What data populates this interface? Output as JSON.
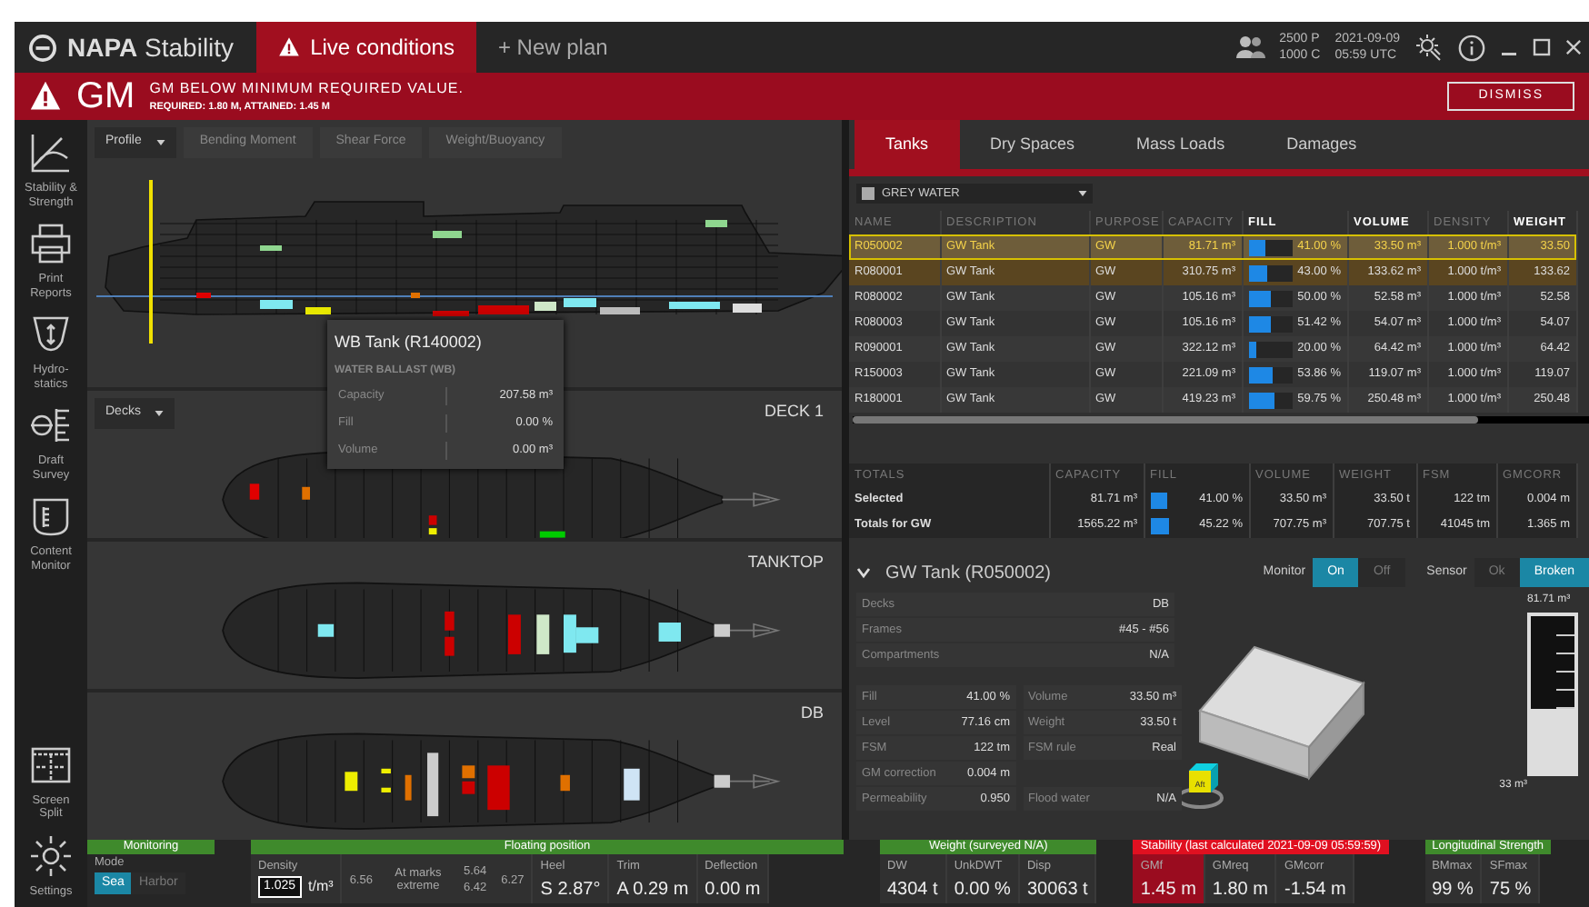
{
  "app": {
    "logo": "**NAPA** Stability",
    "tabs": [
      {
        "label": "Live conditions",
        "selected": true,
        "kind": "warning"
      },
      {
        "label": "+ New plan",
        "selected": false,
        "kind": "plain"
      }
    ],
    "persons": [
      "2500 P",
      "1000 C"
    ],
    "datetime": [
      "2021-09-09",
      "05:59 UTC"
    ]
  },
  "alert": {
    "code": "GM",
    "title": "GM BELOW MINIMUM REQUIRED VALUE.",
    "detail": "REQUIRED: 1.80 M, ATTAINED: 1.45 M",
    "button": "DISMISS"
  },
  "sidebar": {
    "items": [
      {
        "lines": [
          "Stability &",
          "Strength"
        ],
        "kind": "stability"
      },
      {
        "lines": [
          "Print",
          "Reports"
        ],
        "kind": "print"
      },
      {
        "lines": [
          "Hydro-",
          "statics"
        ],
        "kind": "hydro"
      },
      {
        "lines": [
          "Draft",
          "Survey"
        ],
        "kind": "draft"
      },
      {
        "lines": [
          "Content",
          "Monitor"
        ],
        "kind": "content"
      }
    ],
    "bottom": [
      {
        "lines": [
          "Screen",
          "Split"
        ],
        "kind": "split"
      },
      {
        "lines": [
          "Settings"
        ],
        "kind": "settings"
      }
    ]
  },
  "profile": {
    "view_select": "Profile",
    "tabs": [
      "Bending Moment",
      "Shear Force",
      "Weight/Buoyancy"
    ],
    "tooltip": {
      "title": "WB Tank (R140002)",
      "subtitle": "WATER BALLAST (WB)",
      "rows": [
        {
          "label": "Capacity",
          "value": "207.58 m³"
        },
        {
          "label": "Fill",
          "value": "0.00 %"
        },
        {
          "label": "Volume",
          "value": "0.00 m³"
        }
      ]
    }
  },
  "decks": {
    "select": "Decks",
    "views": [
      {
        "label": "DECK 1",
        "kind": "deck1"
      },
      {
        "label": "TANKTOP",
        "kind": "tanktop"
      },
      {
        "label": "DB",
        "kind": "db"
      }
    ]
  },
  "tanks_panel": {
    "tabs": [
      {
        "label": "Tanks",
        "selected": true
      },
      {
        "label": "Dry Spaces",
        "selected": false
      },
      {
        "label": "Mass Loads",
        "selected": false
      },
      {
        "label": "Damages",
        "selected": false
      }
    ],
    "filter": {
      "label": "GREY WATER",
      "checked": false
    },
    "columns": [
      {
        "label": "NAME",
        "emphasis": false
      },
      {
        "label": "DESCRIPTION",
        "emphasis": false
      },
      {
        "label": "PURPOSE",
        "emphasis": false
      },
      {
        "label": "CAPACITY",
        "emphasis": false
      },
      {
        "label": "FILL",
        "emphasis": true
      },
      {
        "label": "VOLUME",
        "emphasis": true
      },
      {
        "label": "DENSITY",
        "emphasis": false
      },
      {
        "label": "WEIGHT",
        "emphasis": true
      }
    ],
    "rows": [
      {
        "name": "R050002",
        "description": "GW Tank",
        "purpose": "GW",
        "capacity": "81.71 m³",
        "fill": "41.00 %",
        "level": 0.41,
        "volume": "33.50 m³",
        "density": "1.000 t/m³",
        "weight": "33.50",
        "selected": true,
        "highlighted": false
      },
      {
        "name": "R080001",
        "description": "GW Tank",
        "purpose": "GW",
        "capacity": "310.75 m³",
        "fill": "43.00 %",
        "level": 0.43,
        "volume": "133.62 m³",
        "density": "1.000 t/m³",
        "weight": "133.62",
        "selected": false,
        "highlighted": true
      },
      {
        "name": "R080002",
        "description": "GW Tank",
        "purpose": "GW",
        "capacity": "105.16 m³",
        "fill": "50.00 %",
        "level": 0.5,
        "volume": "52.58 m³",
        "density": "1.000 t/m³",
        "weight": "52.58",
        "selected": false,
        "highlighted": false
      },
      {
        "name": "R080003",
        "description": "GW Tank",
        "purpose": "GW",
        "capacity": "105.16 m³",
        "fill": "51.42 %",
        "level": 0.5142,
        "volume": "54.07 m³",
        "density": "1.000 t/m³",
        "weight": "54.07",
        "selected": false,
        "highlighted": false
      },
      {
        "name": "R090001",
        "description": "GW Tank",
        "purpose": "GW",
        "capacity": "322.12 m³",
        "fill": "20.00 %",
        "level": 0.2,
        "volume": "64.42 m³",
        "density": "1.000 t/m³",
        "weight": "64.42",
        "selected": false,
        "highlighted": false
      },
      {
        "name": "R150003",
        "description": "GW Tank",
        "purpose": "GW",
        "capacity": "221.09 m³",
        "fill": "53.86 %",
        "level": 0.5386,
        "volume": "119.07 m³",
        "density": "1.000 t/m³",
        "weight": "119.07",
        "selected": false,
        "highlighted": false
      },
      {
        "name": "R180001",
        "description": "GW Tank",
        "purpose": "GW",
        "capacity": "419.23 m³",
        "fill": "59.75 %",
        "level": 0.5975,
        "volume": "250.48 m³",
        "density": "1.000 t/m³",
        "weight": "250.48",
        "selected": false,
        "highlighted": false
      }
    ]
  },
  "totals": {
    "columns": [
      "TOTALS",
      "CAPACITY",
      "FILL",
      "VOLUME",
      "WEIGHT",
      "FSM",
      "GMCORR"
    ],
    "rows": [
      {
        "label": "Selected",
        "capacity": "81.71 m³",
        "fill": "41.00 %",
        "level": 0.41,
        "volume": "33.50 m³",
        "weight": "33.50 t",
        "fsm": "122 tm",
        "gmcorr": "0.004 m"
      },
      {
        "label": "Totals for GW",
        "capacity": "1565.22 m³",
        "fill": "45.22 %",
        "level": 0.4522,
        "volume": "707.75 m³",
        "weight": "707.75 t",
        "fsm": "41045 tm",
        "gmcorr": "1.365 m"
      }
    ]
  },
  "detail": {
    "title": "GW Tank (R050002)",
    "expanded": true,
    "monitor": {
      "label": "Monitor",
      "options": [
        {
          "label": "On",
          "selected": true
        },
        {
          "label": "Off",
          "selected": false
        }
      ]
    },
    "sensor": {
      "label": "Sensor",
      "options": [
        {
          "label": "Ok",
          "selected": false
        },
        {
          "label": "Broken",
          "selected": true
        }
      ]
    },
    "info": [
      {
        "label": "Decks",
        "value": "DB"
      },
      {
        "label": "Frames",
        "value": "#45 - #56"
      },
      {
        "label": "Compartments",
        "value": "N/A"
      }
    ],
    "props": [
      [
        {
          "label": "Fill",
          "value": "41.00 %"
        },
        {
          "label": "Volume",
          "value": "33.50 m³"
        }
      ],
      [
        {
          "label": "Level",
          "value": "77.16 cm"
        },
        {
          "label": "Weight",
          "value": "33.50 t"
        }
      ],
      [
        {
          "label": "FSM",
          "value": "122 tm"
        },
        {
          "label": "FSM rule",
          "value": "Real"
        }
      ],
      [
        {
          "label": "GM correction",
          "value": "0.004 m"
        }
      ],
      [
        {
          "label": "Permeability",
          "value": "0.950"
        },
        {
          "label": "Flood water",
          "value": "N/A"
        }
      ]
    ],
    "cube_label": "Aft",
    "gauge": {
      "capacity": "81.71 m³",
      "mark": "33 m³",
      "level": 0.41
    }
  },
  "status": {
    "monitoring": {
      "title": "Monitoring",
      "mode_label": "Mode",
      "options": [
        {
          "label": "Sea",
          "selected": true
        },
        {
          "label": "Harbor",
          "selected": false
        }
      ]
    },
    "floating": {
      "title": "Floating position",
      "density_label": "Density",
      "density": "1.025",
      "density_unit": "t/m³",
      "draft_aft": "6.56",
      "marks_label": "At marks extreme",
      "marks": [
        "5.64",
        "6.42"
      ],
      "draft_fwd": "6.27",
      "items": [
        {
          "label": "Heel",
          "value": "S 2.87°"
        },
        {
          "label": "Trim",
          "value": "A 0.29 m"
        },
        {
          "label": "Deflection",
          "value": "0.00 m"
        }
      ]
    },
    "weight": {
      "title": "Weight",
      "note": "(surveyed N/A)",
      "alarm": false,
      "items": [
        {
          "label": "DW",
          "value": "4304 t",
          "alarm": false
        },
        {
          "label": "UnkDWT",
          "value": "0.00 %",
          "alarm": false
        },
        {
          "label": "Disp",
          "value": "30063 t",
          "alarm": false
        }
      ]
    },
    "stability": {
      "title": "Stability",
      "note": "(last calculated 2021-09-09 05:59:59)",
      "alarm": true,
      "items": [
        {
          "label": "GMf",
          "value": "1.45 m",
          "alarm": true
        },
        {
          "label": "GMreq",
          "value": "1.80 m",
          "alarm": false
        },
        {
          "label": "GMcorr",
          "value": "-1.54 m",
          "alarm": false
        }
      ]
    },
    "strength": {
      "title": "Longitudinal Strength",
      "alarm": false,
      "items": [
        {
          "label": "BMmax",
          "value": "99 %",
          "alarm": false
        },
        {
          "label": "SFmax",
          "value": "75 %",
          "alarm": false
        }
      ]
    }
  }
}
